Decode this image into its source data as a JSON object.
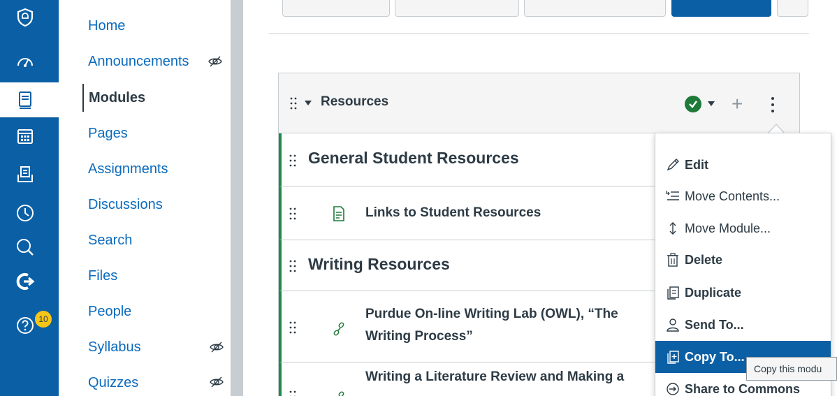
{
  "global_nav": {
    "items": [
      {
        "icon": "shield-logo-icon"
      },
      {
        "icon": "dashboard-icon"
      },
      {
        "icon": "courses-icon"
      },
      {
        "icon": "calendar-icon"
      },
      {
        "icon": "inbox-icon"
      },
      {
        "icon": "history-icon"
      },
      {
        "icon": "search-icon"
      },
      {
        "icon": "external-tool-icon"
      },
      {
        "icon": "help-icon"
      }
    ],
    "help_badge": "10",
    "color": "#0b5fa5"
  },
  "course_nav": {
    "items": [
      {
        "label": "Home"
      },
      {
        "label": "Announcements"
      },
      {
        "label": "Modules"
      },
      {
        "label": "Pages"
      },
      {
        "label": "Assignments"
      },
      {
        "label": "Discussions"
      },
      {
        "label": "Search"
      },
      {
        "label": "Files"
      },
      {
        "label": "People"
      },
      {
        "label": "Syllabus"
      },
      {
        "label": "Quizzes"
      }
    ],
    "active": "Modules"
  },
  "module": {
    "title": "Resources",
    "published_color": "#1f7a3a",
    "add_label": "+",
    "rows": [
      {
        "type": "subheader",
        "title": "General Student Resources"
      },
      {
        "type": "page",
        "title": "Links to Student Resources"
      },
      {
        "type": "subheader",
        "title": "Writing Resources"
      },
      {
        "type": "link",
        "title_line1": "Purdue On-line Writing Lab (OWL), “The",
        "title_line2": "Writing Process”"
      },
      {
        "type": "link",
        "title_line1": "Writing a Literature Review and Making a"
      }
    ]
  },
  "menu": {
    "items": [
      {
        "label": "Edit",
        "icon": "pencil-icon"
      },
      {
        "label": "Move Contents...",
        "icon": "move-contents-icon"
      },
      {
        "label": "Move Module...",
        "icon": "move-vertical-icon"
      },
      {
        "label": "Delete",
        "icon": "trash-icon"
      },
      {
        "label": "Duplicate",
        "icon": "duplicate-icon"
      },
      {
        "label": "Send To...",
        "icon": "send-user-icon"
      },
      {
        "label": "Copy To...",
        "icon": "copy-to-icon"
      },
      {
        "label": "Share to Commons",
        "icon": "commons-icon"
      }
    ],
    "active": "Copy To...",
    "tooltip": "Copy this modu"
  }
}
